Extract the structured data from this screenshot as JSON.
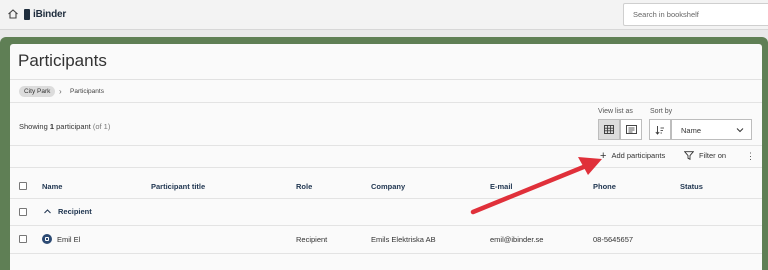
{
  "app": {
    "brand": "iBinder"
  },
  "search": {
    "placeholder": "Search in bookshelf"
  },
  "page": {
    "title": "Participants"
  },
  "breadcrumb": {
    "project": "City Park",
    "current": "Participants"
  },
  "summary": {
    "prefix": "Showing",
    "count": "1",
    "unit": "participant",
    "total_text": "(of 1)"
  },
  "view": {
    "label": "View list as",
    "options": [
      "grid",
      "list"
    ],
    "selected": "grid"
  },
  "sort": {
    "label": "Sort by",
    "value": "Name"
  },
  "actions": {
    "add": "Add participants",
    "filter": "Filter on"
  },
  "table": {
    "columns": [
      "Name",
      "Participant title",
      "Role",
      "Company",
      "E-mail",
      "Phone",
      "Status"
    ],
    "group": {
      "label": "Recipient",
      "expanded": true
    },
    "rows": [
      {
        "name": "Emil El",
        "participant_title": "",
        "role": "Recipient",
        "company": "Emils Elektriska AB",
        "email": "emil@ibinder.se",
        "phone": "08-5645657",
        "status": ""
      }
    ]
  },
  "colors": {
    "frame": "#5f7f55",
    "header_text": "#1f3550",
    "arrow": "#e0303a"
  }
}
